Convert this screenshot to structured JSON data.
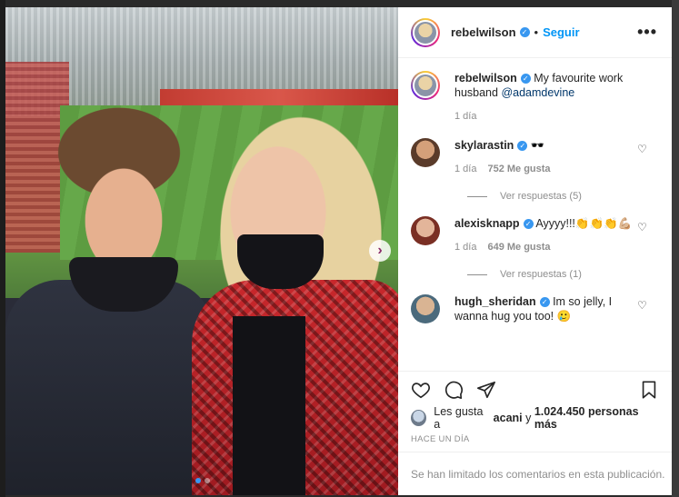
{
  "post": {
    "author": "rebelwilson",
    "follow_label": "Seguir",
    "separator": "•",
    "more_label": "•••",
    "carousel_next": "›",
    "caption_text": "My favourite work husband ",
    "caption_mention": "@adamdevine",
    "caption_time": "1 día"
  },
  "comments": [
    {
      "username": "skylarastin",
      "text": "🕶️",
      "time": "1 día",
      "likes": "752 Me gusta",
      "replies": "Ver respuestas (5)"
    },
    {
      "username": "alexisknapp",
      "text": "Ayyyy!!!👏👏👏💪🏼",
      "text_cont": "💪🏼",
      "time": "1 día",
      "likes": "649 Me gusta",
      "replies": "Ver respuestas (1)"
    },
    {
      "username": "hugh_sheridan",
      "text": "Im so jelly, I wanna hug you too! 🥲"
    }
  ],
  "footer": {
    "likes_prefix": "Les gusta a ",
    "likes_user": "acani",
    "likes_mid": " y ",
    "likes_count": "1.024.450 personas más",
    "date": "HACE UN DÍA",
    "limited": "Se han limitado los comentarios en esta publicación."
  },
  "icons": {
    "verified": "✓",
    "heart": "♡"
  },
  "colors": {
    "link_blue": "#0095f6",
    "verified_blue": "#3897f0",
    "mention": "#00376b",
    "muted": "#8e8e8e"
  }
}
